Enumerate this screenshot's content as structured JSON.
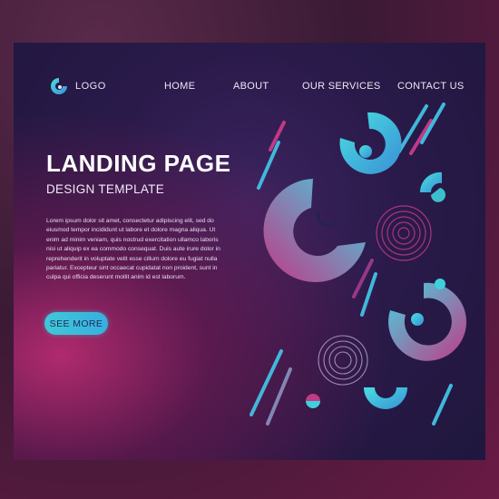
{
  "brand": {
    "logo_text": "LOGO",
    "logo_icon": "swirl-logo-icon"
  },
  "nav": {
    "items": [
      "HOME",
      "ABOUT",
      "OUR SERVICES",
      "CONTACT US"
    ]
  },
  "hero": {
    "title": "LANDING PAGE",
    "subtitle": "DESIGN TEMPLATE",
    "body": "Lorem ipsum dolor sit amet, consectetur adipiscing elit, sed do eiusmod tempor incididunt ut labore et dolore magna aliqua. Ut enim ad minim veniam, quis nostrud exercitation ullamco laboris nisi ut aliquip ex ea commodo consequat. Duis aute irure dolor in reprehenderit in voluptate velit esse cillum dolore eu fugiat nulla pariatur. Excepteur sint occaecat cupidatat non proident, sunt in culpa qui officia deserunt mollit anim id est laborum.",
    "cta_label": "SEE MORE"
  },
  "colors": {
    "cyan": "#3fd0dc",
    "magenta": "#c23a86",
    "background": "#231a45"
  }
}
